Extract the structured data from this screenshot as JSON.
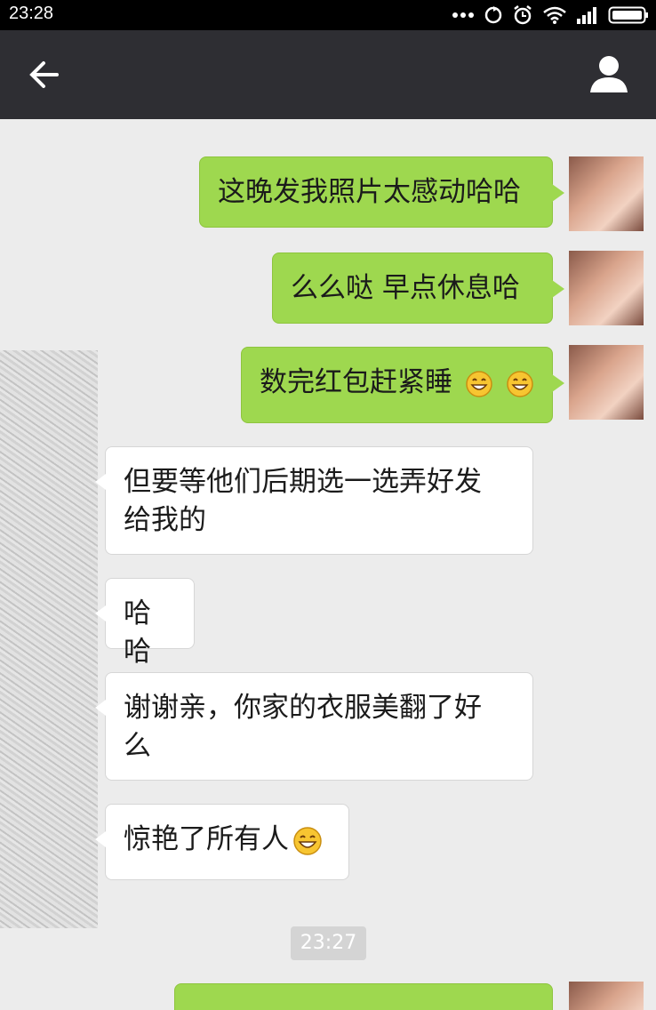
{
  "status_bar": {
    "time": "23:28"
  },
  "header": {
    "back_icon": "arrow-left-icon",
    "profile_icon": "person-icon",
    "title": ""
  },
  "messages": [
    {
      "side": "sent",
      "text": "这晚发我照片太感动哈哈"
    },
    {
      "side": "sent",
      "text": "么么哒 早点休息哈"
    },
    {
      "side": "sent",
      "text": "数完红包赶紧睡",
      "emoji_count": 2
    },
    {
      "side": "received",
      "lines": [
        "但要等他们后期选一选弄好发",
        "给我的"
      ]
    },
    {
      "side": "received",
      "text": "哈哈"
    },
    {
      "side": "received",
      "lines": [
        "谢谢亲，你家的衣服美翻了好",
        "么"
      ]
    },
    {
      "side": "received",
      "text": "惊艳了所有人",
      "emoji_count": 1
    }
  ],
  "time_label": "23:27",
  "colors": {
    "sent_bubble": "#9ed84f",
    "received_bubble": "#ffffff",
    "header": "#2e2e33",
    "background": "#ececec"
  }
}
